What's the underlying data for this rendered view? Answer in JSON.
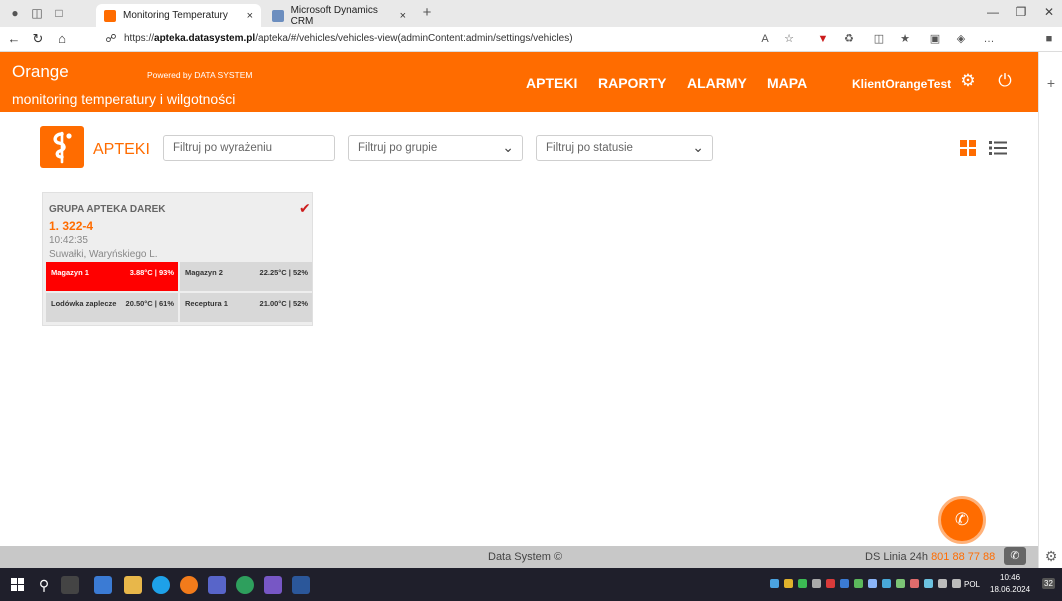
{
  "browser": {
    "tabs": [
      {
        "title": "Monitoring Temperatury",
        "active": true
      },
      {
        "title": "Microsoft Dynamics CRM",
        "active": false
      }
    ],
    "url_prefix": "https://",
    "url_host": "apteka.datasystem.pl",
    "url_path": "/apteka/#/vehicles/vehicles-view(adminContent:admin/settings/vehicles)",
    "new_tab_glyph": "+",
    "close_glyph": "×"
  },
  "header": {
    "brand": "Orange",
    "powered_by": "Powered by DATA SYSTEM",
    "subtitle": "monitoring temperatury i wilgotności",
    "nav": [
      "APTEKI",
      "RAPORTY",
      "ALARMY",
      "MAPA"
    ],
    "user": "KlientOrangeTest",
    "icons": {
      "settings": "gear-icon",
      "logout": "power-icon"
    }
  },
  "toolbar": {
    "title": "APTEKI",
    "search_placeholder": "Filtruj po wyrażeniu",
    "group_filter": "Filtruj po grupie",
    "status_filter": "Filtruj po statusie",
    "view_icons": [
      "grid-view-icon",
      "list-view-icon"
    ]
  },
  "group_card": {
    "group": "GRUPA APTEKA DAREK",
    "pharmacy_number": "1. 322-4",
    "time": "10:42:35",
    "address": "Suwałki, Waryńskiego L.",
    "sensors": [
      {
        "name": "Magazyn 1",
        "value": "3.88°C | 93%",
        "alarm": true
      },
      {
        "name": "Magazyn 2",
        "value": "22.25°C | 52%",
        "alarm": false
      },
      {
        "name": "Lodówka zaplecze",
        "value": "20.50°C | 61%",
        "alarm": false
      },
      {
        "name": "Receptura 1",
        "value": "21.00°C | 52%",
        "alarm": false
      }
    ]
  },
  "footer": {
    "copyright": "Data System ©",
    "hotline_label": "DS Linia 24h",
    "hotline_number": "801 88 77 88"
  },
  "taskbar": {
    "lang": "POL",
    "time": "10:46",
    "date": "18.06.2024",
    "notifications": "32"
  },
  "colors": {
    "brand_orange": "#ff6c00",
    "alarm_red": "#ff0000",
    "check_red": "#cc1c1c"
  }
}
